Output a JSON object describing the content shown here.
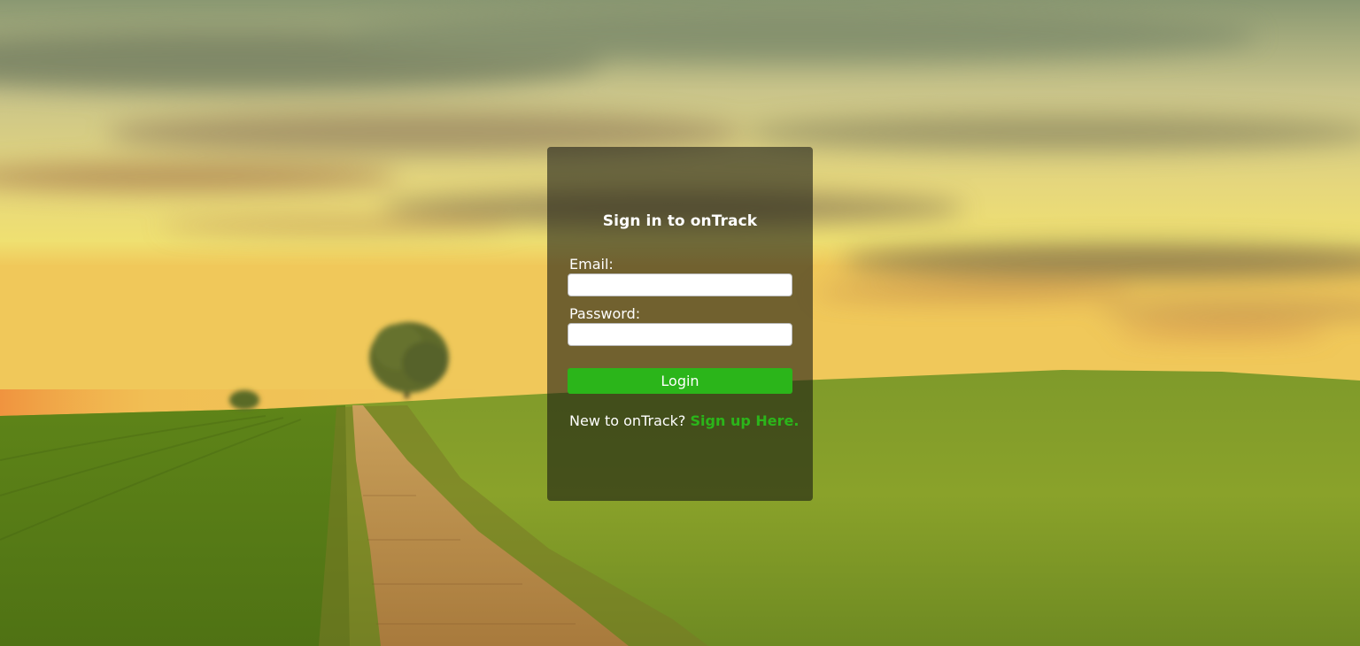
{
  "login": {
    "title": "Sign in to onTrack",
    "email_label": "Email:",
    "email_value": "",
    "password_label": "Password:",
    "password_value": "",
    "button_label": "Login",
    "signup_prompt": "New to onTrack?",
    "signup_link": "Sign up Here."
  },
  "colors": {
    "accent": "#2bb51a",
    "panel_overlay": "rgba(20, 22, 18, 0.58)",
    "text": "#ffffff"
  }
}
